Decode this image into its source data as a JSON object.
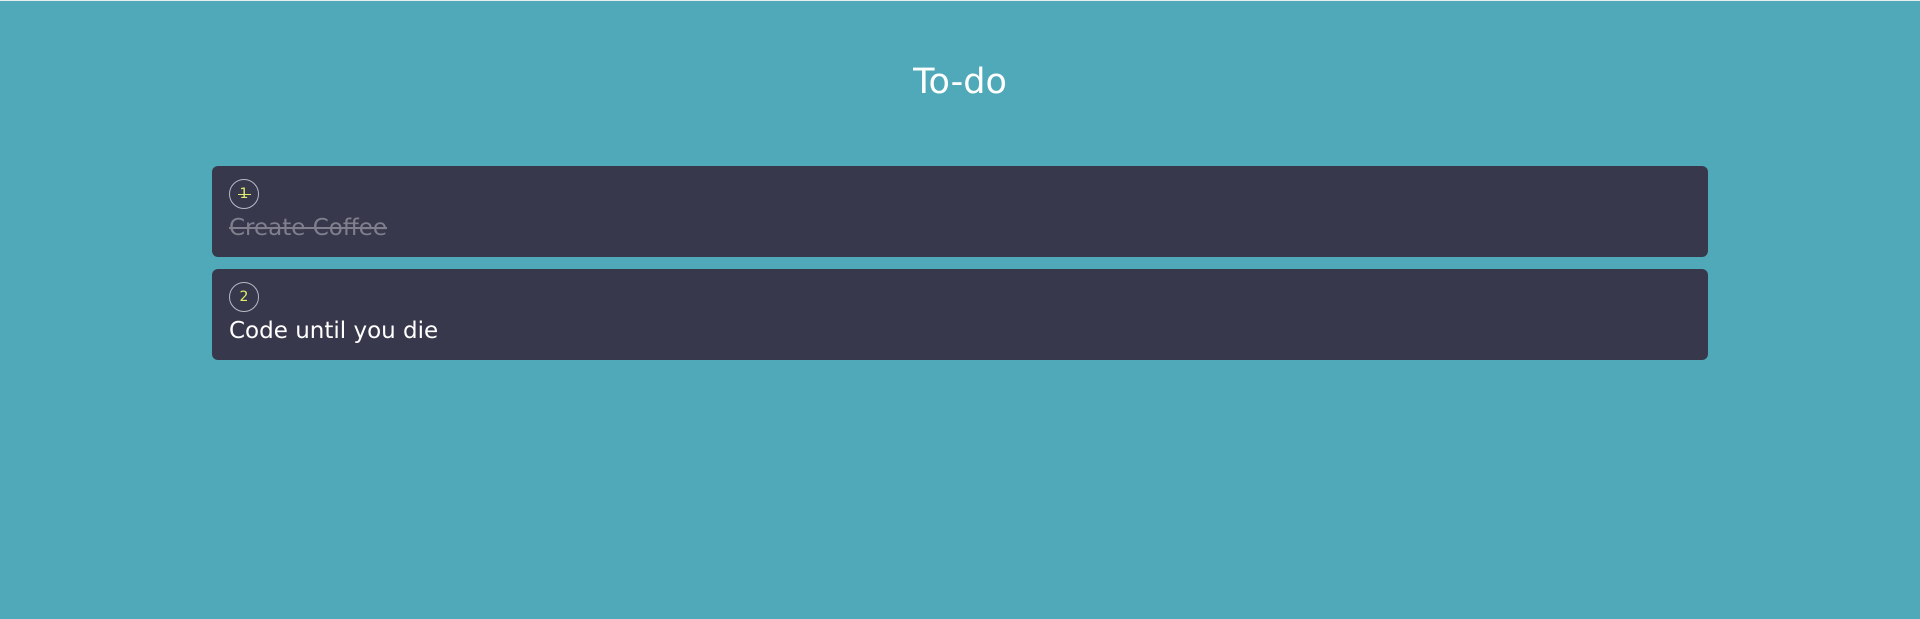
{
  "header": {
    "title": "To-do"
  },
  "todos": [
    {
      "number": "1",
      "text": "Create Coffee",
      "completed": true
    },
    {
      "number": "2",
      "text": "Code until you die",
      "completed": false
    }
  ],
  "colors": {
    "background": "#50a9b9",
    "card": "#38384c",
    "number": "#e2ef6e",
    "text": "#ffffff",
    "completed_text": "#7f7f8e"
  }
}
